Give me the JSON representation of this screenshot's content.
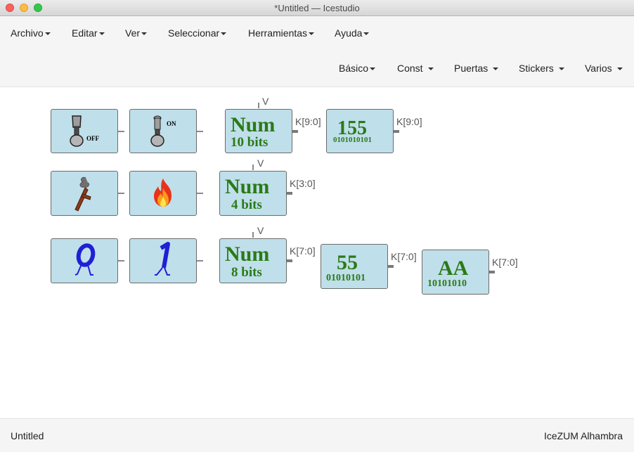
{
  "window": {
    "title": "*Untitled — Icestudio"
  },
  "menu": [
    {
      "label": "Archivo"
    },
    {
      "label": "Editar"
    },
    {
      "label": "Ver"
    },
    {
      "label": "Seleccionar"
    },
    {
      "label": "Herramientas"
    },
    {
      "label": "Ayuda"
    }
  ],
  "palette": [
    {
      "label": "Básico"
    },
    {
      "label": "Const"
    },
    {
      "label": "Puertas"
    },
    {
      "label": "Stickers"
    },
    {
      "label": "Varios"
    }
  ],
  "blocks": {
    "switch_off": {
      "text": "OFF",
      "icon": "toggle-switch-off-icon"
    },
    "switch_on": {
      "text": "ON",
      "icon": "toggle-switch-on-icon"
    },
    "match": {
      "icon": "smoking-match-icon"
    },
    "fire": {
      "icon": "fire-icon"
    },
    "zero": {
      "icon": "digit-zero-character-icon"
    },
    "one": {
      "icon": "digit-one-character-icon"
    },
    "num10": {
      "title": "Num",
      "sub": "10 bits",
      "in": "V",
      "out": "K[9:0]"
    },
    "num4": {
      "title": "Num",
      "sub": "4 bits",
      "in": "V",
      "out": "K[3:0]"
    },
    "num8": {
      "title": "Num",
      "sub": "8 bits",
      "in": "V",
      "out": "K[7:0]"
    },
    "c155": {
      "value": "155",
      "bits": "0101010101",
      "out": "K[9:0]"
    },
    "c55": {
      "value": "55",
      "bits": "01010101",
      "out": "K[7:0]"
    },
    "cAA": {
      "value": "AA",
      "bits": "10101010",
      "out": "K[7:0]"
    }
  },
  "status": {
    "left": "Untitled",
    "right": "IceZUM Alhambra"
  },
  "colors": {
    "block_fill": "#bfdfea",
    "block_text": "#2a7a16",
    "character_blue": "#1f1fd6"
  }
}
